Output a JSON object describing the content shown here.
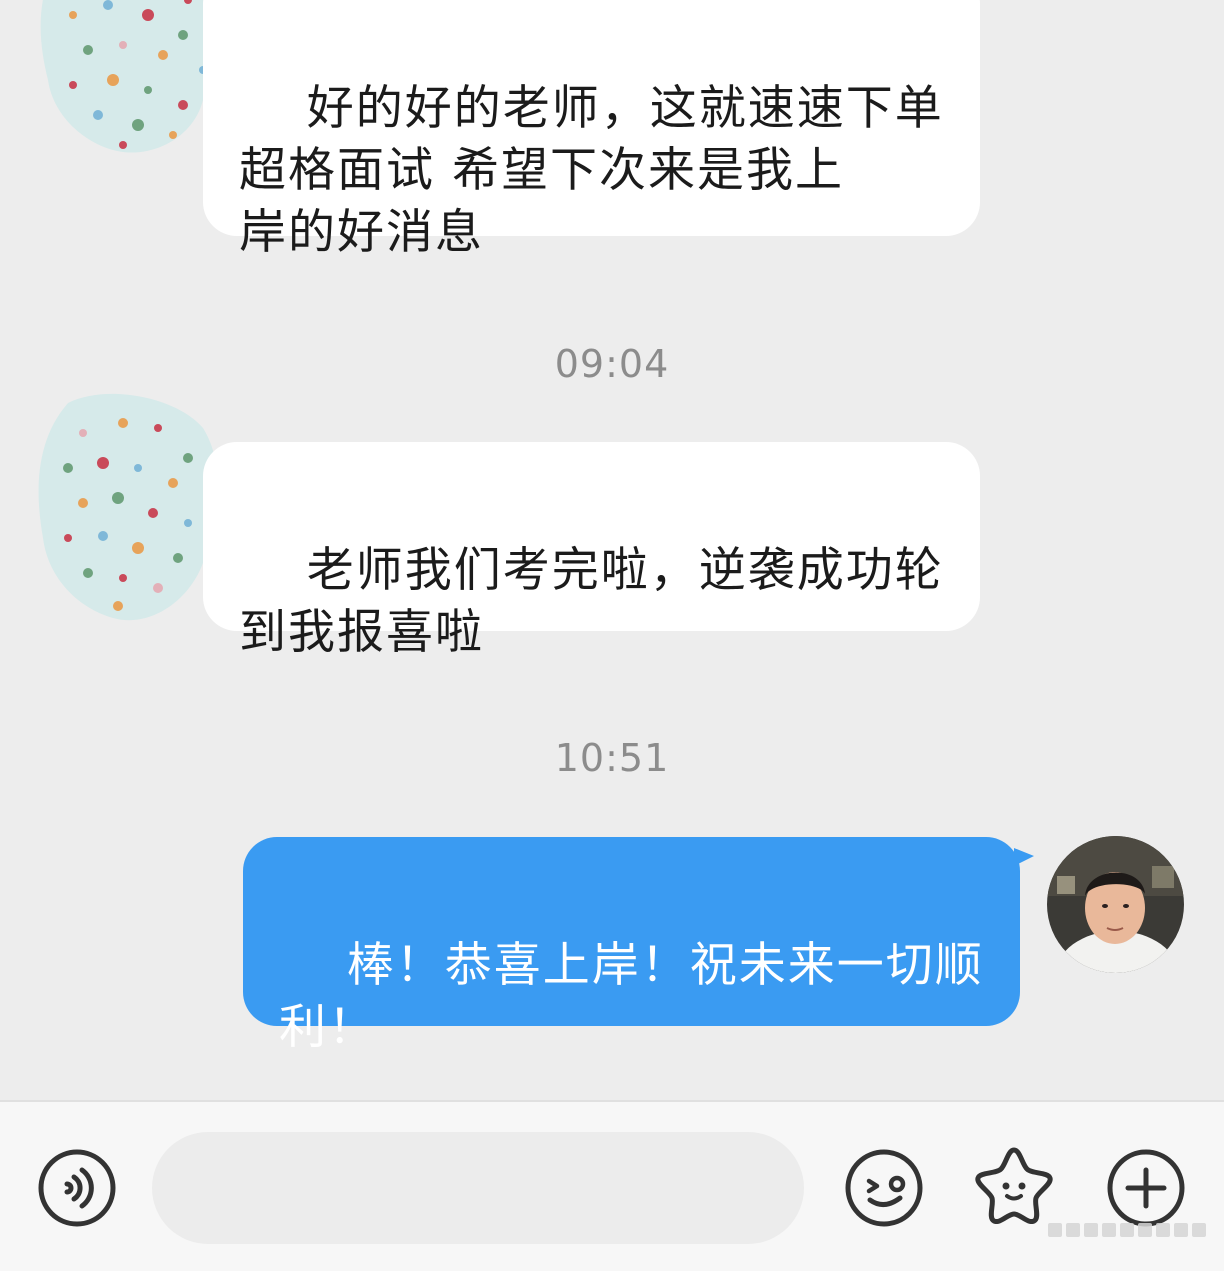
{
  "messages": [
    {
      "id": "m1",
      "from": "other",
      "text": "好的好的老师，这就速速下单\n超格面试 希望下次来是我上\n岸的好消息"
    },
    {
      "id": "t1",
      "type": "timestamp",
      "text": "09:04"
    },
    {
      "id": "m2",
      "from": "other",
      "text": "老师我们考完啦，逆袭成功轮\n到我报喜啦"
    },
    {
      "id": "t2",
      "type": "timestamp",
      "text": "10:51"
    },
    {
      "id": "m3",
      "from": "me",
      "text": "棒！恭喜上岸！祝未来一切顺\n利！"
    }
  ],
  "input_bar": {
    "message_value": "",
    "icons": [
      "voice-icon",
      "emoji-icon",
      "sticker-star-icon",
      "plus-icon"
    ]
  },
  "colors": {
    "background": "#ededed",
    "incoming_bubble": "#ffffff",
    "outgoing_bubble": "#3a9bf2",
    "timestamp_text": "#8c8c8c",
    "input_bar": "#f7f7f7"
  }
}
